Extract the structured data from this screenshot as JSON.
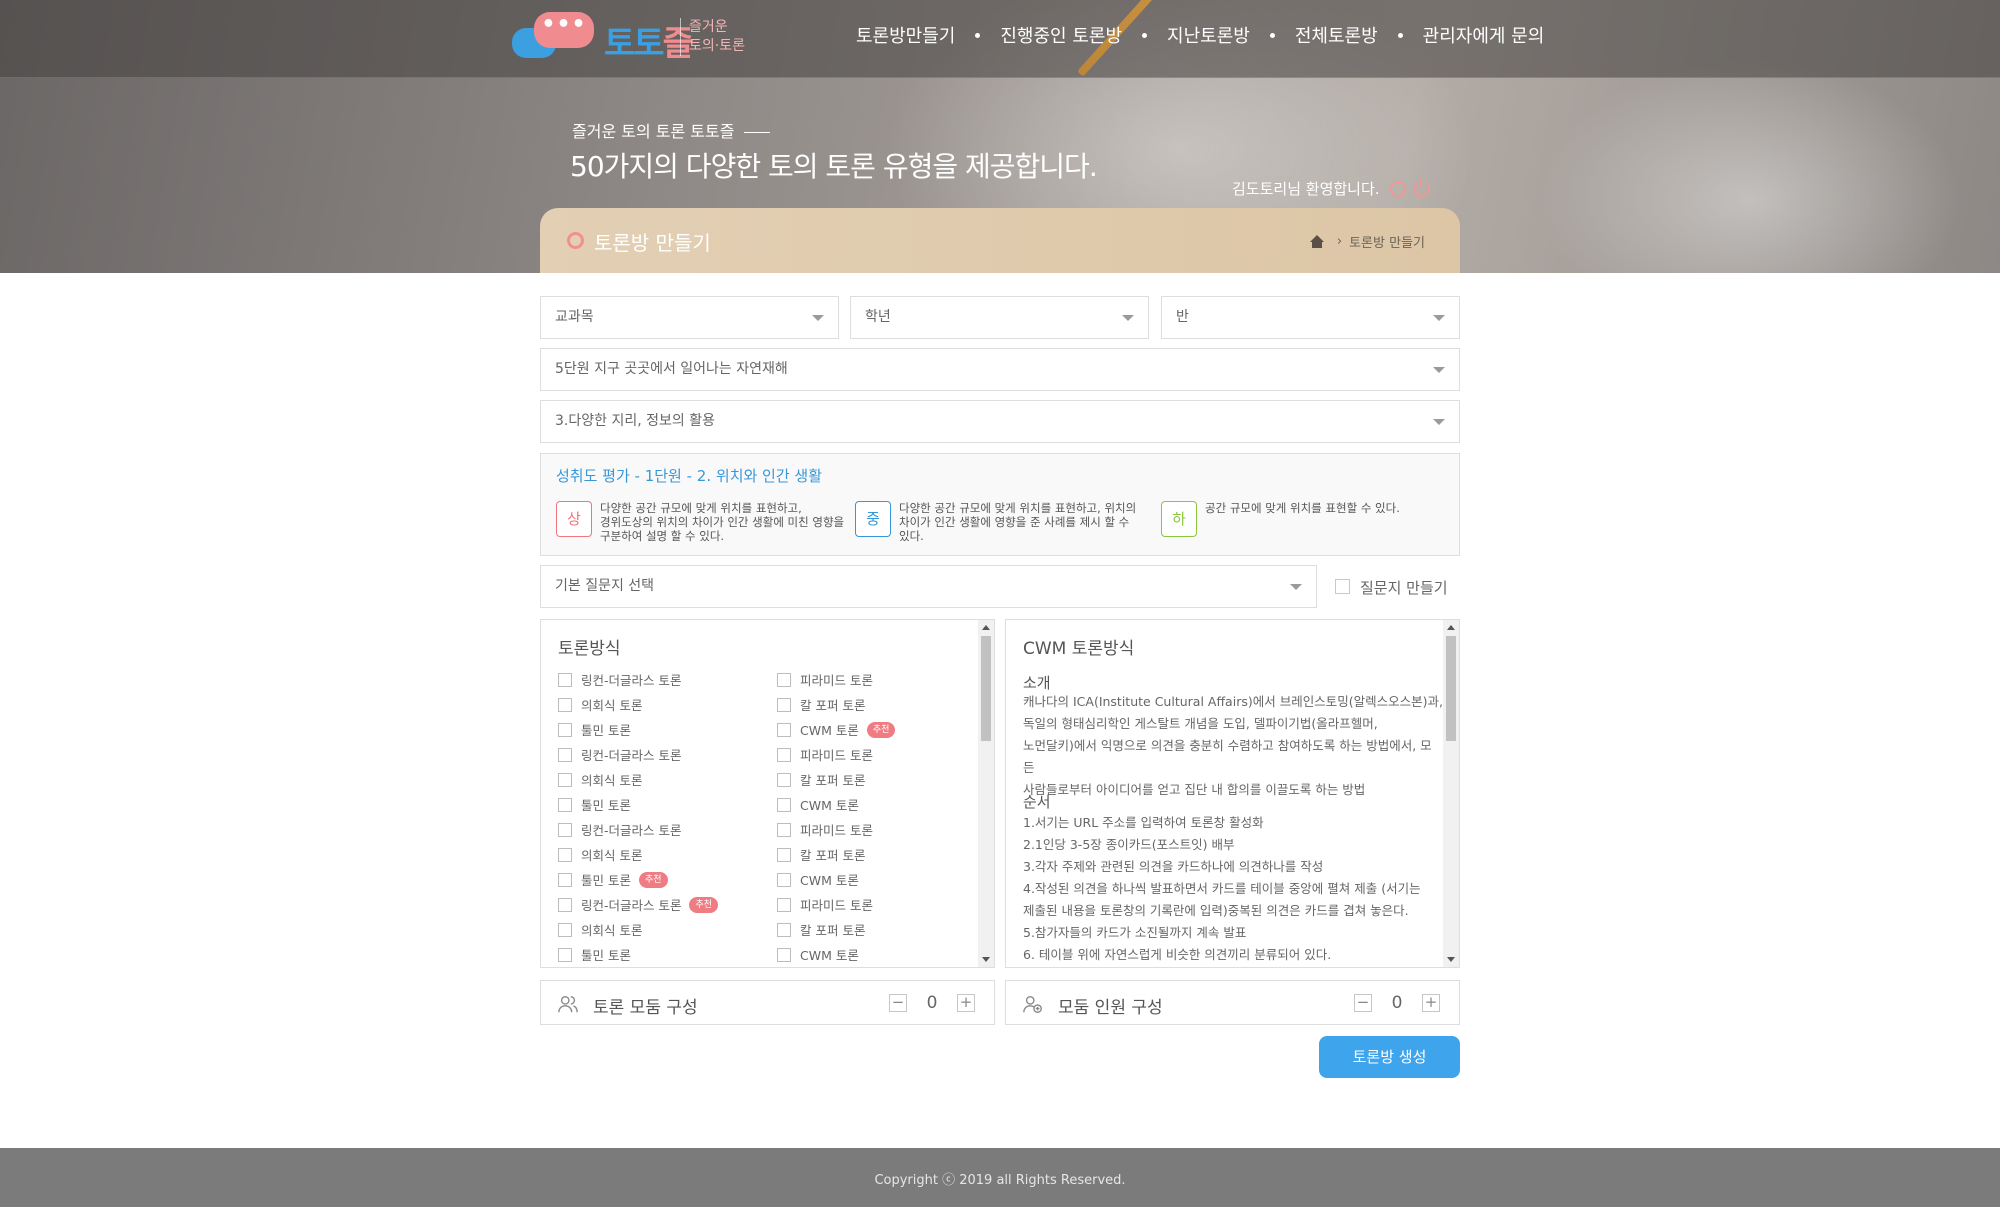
{
  "logo": {
    "bubble": "•••",
    "title_part1": "토토",
    "title_part2": "즐",
    "sub_line1": "즐거운",
    "sub_line2": "토의·토론"
  },
  "nav": {
    "items": [
      "토론방만들기",
      "진행중인 토론방",
      "지난토론방",
      "전체토론방",
      "관리자에게 문의"
    ]
  },
  "hero": {
    "subtitle": "즐거운 토의 토론 토토즐",
    "title": "50가지의 다양한 토의 토론 유형을 제공합니다.",
    "welcome": "김도토리님 환영합니다."
  },
  "page": {
    "title": "토론방 만들기",
    "breadcrumb": "토론방 만들기"
  },
  "form": {
    "subject": "교과목",
    "grade": "학년",
    "class": "반",
    "unit": "5단원 지구 곳곳에서 일어나는 자연재해",
    "lesson": "3.다양한 지리, 정보의 활용",
    "question_select": "기본 질문지 선택",
    "make_question_label": "질문지 만들기"
  },
  "achievement": {
    "title": "성취도 평가 - 1단원 - 2. 위치와 인간 생활",
    "levels": [
      {
        "badge": "상",
        "color": "#f0757d",
        "text_lines": [
          "다양한 공간 규모에 맞게 위치를 표현하고,",
          "경위도상의 위치의 차이가 인간 생활에 미친 영향을",
          "구분하여 설명 할 수 있다."
        ]
      },
      {
        "badge": "중",
        "color": "#3997d8",
        "text_lines": [
          "다양한 공간 규모에 맞게 위치를 표현하고, 위치의",
          "차이가 인간 생활에 영향을 준 사례를 제시 할 수",
          "있다."
        ]
      },
      {
        "badge": "하",
        "color": "#8cc63f",
        "text_lines": [
          "공간 규모에 맞게 위치를 표현할 수 있다."
        ]
      }
    ]
  },
  "methods": {
    "title": "토론방식",
    "recommend_label": "추천",
    "left": [
      {
        "label": "링컨-더글라스 토론",
        "rec": false
      },
      {
        "label": "의회식 토론",
        "rec": false
      },
      {
        "label": "툴민 토론",
        "rec": false
      },
      {
        "label": "링컨-더글라스 토론",
        "rec": false
      },
      {
        "label": "의회식 토론",
        "rec": false
      },
      {
        "label": "툴민 토론",
        "rec": false
      },
      {
        "label": "링컨-더글라스 토론",
        "rec": false
      },
      {
        "label": "의회식 토론",
        "rec": false
      },
      {
        "label": "툴민 토론",
        "rec": true
      },
      {
        "label": "링컨-더글라스 토론",
        "rec": true
      },
      {
        "label": "의회식 토론",
        "rec": false
      },
      {
        "label": "툴민 토론",
        "rec": false
      }
    ],
    "right": [
      {
        "label": "피라미드 토론",
        "rec": false
      },
      {
        "label": "칼 포퍼 토론",
        "rec": false
      },
      {
        "label": "CWM 토론",
        "rec": true
      },
      {
        "label": "피라미드 토론",
        "rec": false
      },
      {
        "label": "칼 포퍼 토론",
        "rec": false
      },
      {
        "label": "CWM 토론",
        "rec": false
      },
      {
        "label": "피라미드 토론",
        "rec": false
      },
      {
        "label": "칼 포퍼 토론",
        "rec": false
      },
      {
        "label": "CWM 토론",
        "rec": false
      },
      {
        "label": "피라미드 토론",
        "rec": false
      },
      {
        "label": "칼 포퍼 토론",
        "rec": false
      },
      {
        "label": "CWM 토론",
        "rec": false
      }
    ]
  },
  "description": {
    "title": "CWM 토론방식",
    "intro_heading": "소개",
    "intro_lines": [
      "캐나다의 ICA(Institute Cultural Affairs)에서 브레인스토밍(알렉스오스본)과,",
      "독일의 형태심리학인 게스탈트 개념을 도입, 델파이기법(올라프헬머,",
      "노먼달키)에서 익명으로 의견을 충분히 수렴하고 참여하도록 하는 방법에서, 모든",
      "사람들로부터 아이디어를 얻고 집단 내 합의를 이끌도록 하는 방법"
    ],
    "order_heading": "순서",
    "order_lines": [
      "1.서기는 URL 주소를 입력하여 토론창 활성화",
      "2.1인당 3-5장 종이카드(포스트잇) 배부",
      "3.각자 주제와 관련된 의견을 카드하나에 의견하나를 작성",
      "4.작성된 의견을 하나씩 발표하면서 카드를 테이블 중앙에 펼쳐 제출 (서기는",
      "제출된 내용을 토론창의 기록란에 입력)중복된 의견은 카드를 겹쳐 놓은다.",
      "5.참가자들의 카드가 소진될까지 계속 발표",
      "6. 테이블 위에 자연스럽게 비슷한 의견끼리 분류되어 있다."
    ]
  },
  "groups": {
    "label": "토론 모둠 구성",
    "minus": "−",
    "plus": "+",
    "value": "0"
  },
  "members": {
    "label": "모둠 인원 구성",
    "minus": "−",
    "plus": "+",
    "value": "0"
  },
  "create_button": "토론방 생성",
  "footer": "Copyright ⓒ 2019 all Rights Reserved."
}
